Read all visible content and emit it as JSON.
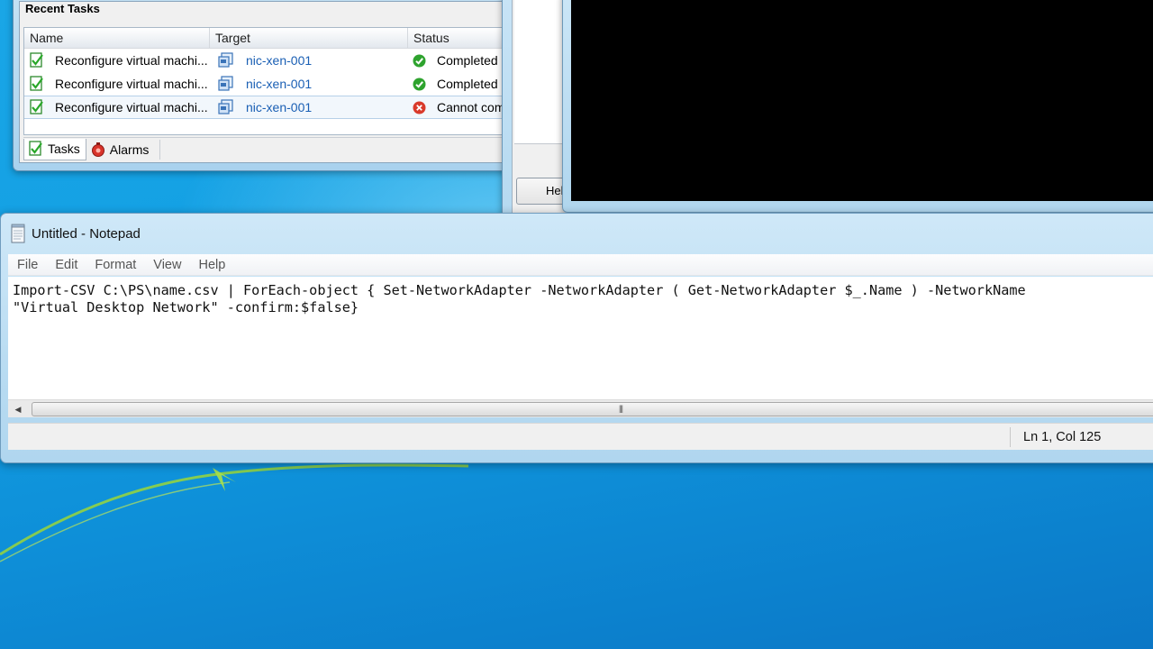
{
  "vsphere": {
    "panel_title": "Recent Tasks",
    "columns": {
      "name": "Name",
      "target": "Target",
      "status": "Status"
    },
    "tasks": [
      {
        "name": "Reconfigure virtual machi...",
        "target": "nic-xen-001",
        "status": "Completed",
        "status_icon": "success-check-icon"
      },
      {
        "name": "Reconfigure virtual machi...",
        "target": "nic-xen-001",
        "status": "Completed",
        "status_icon": "success-check-icon"
      },
      {
        "name": "Reconfigure virtual machi...",
        "target": "nic-xen-001",
        "status": "Cannot comp",
        "status_icon": "error-x-icon"
      }
    ],
    "tabs": {
      "tasks": "Tasks",
      "alarms": "Alarms"
    }
  },
  "dialog": {
    "help_button": "Help"
  },
  "notepad": {
    "title": "Untitled - Notepad",
    "menu": {
      "file": "File",
      "edit": "Edit",
      "format": "Format",
      "view": "View",
      "help": "Help"
    },
    "content": "Import-CSV C:\\PS\\name.csv | ForEach-object { Set-NetworkAdapter -NetworkAdapter ( Get-NetworkAdapter $_.Name ) -NetworkName\n\"Virtual Desktop Network\" -confirm:$false}",
    "status_position": "Ln 1, Col 125"
  },
  "colors": {
    "success": "#2ea32e",
    "error": "#d93a2b",
    "link": "#1a5fb4",
    "console": "#000000"
  }
}
